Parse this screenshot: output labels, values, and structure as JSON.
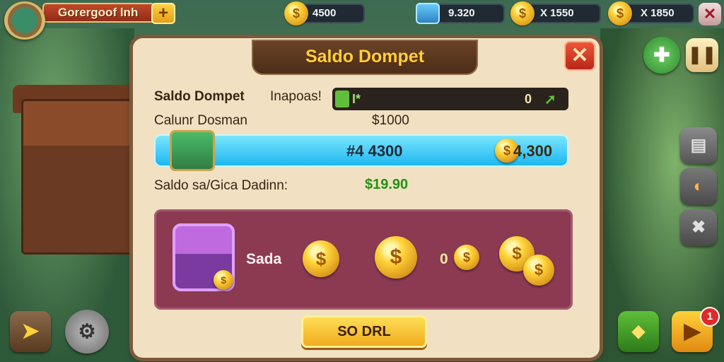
{
  "topbar": {
    "player_name": "Gorergoof lnh",
    "add_label": "+",
    "coins_1": "4500",
    "gems": "9.320",
    "coins_2": "X 1550",
    "coins_3": "X 1850",
    "close_label": "✕"
  },
  "dialog": {
    "title": "Saldo Dompet",
    "close_label": "✕",
    "row1_label": "Saldo Dompet",
    "row1_sub": "Inapoas!",
    "row1_bar_left": "I*",
    "row1_bar_right": "0",
    "row2_label": "Calunr Dosman",
    "row2_value": "$1000",
    "blue_bar_value": "#4 4300",
    "blue_bar_right": "4,300",
    "row3_label": "Saldo sa/Gica Dadinn:",
    "row3_value": "$19.90",
    "reward_label": "Sada",
    "reward_small": "0",
    "collect_label": "SO DRL"
  },
  "side": {
    "badge_count": "1"
  },
  "colors": {
    "dialog_bg": "#f1e1c2",
    "title_gold": "#ffcf3a",
    "blue_bar": "#18b6ee",
    "maroon_panel": "#8b3a52",
    "collect_button": "#f0a81a"
  }
}
